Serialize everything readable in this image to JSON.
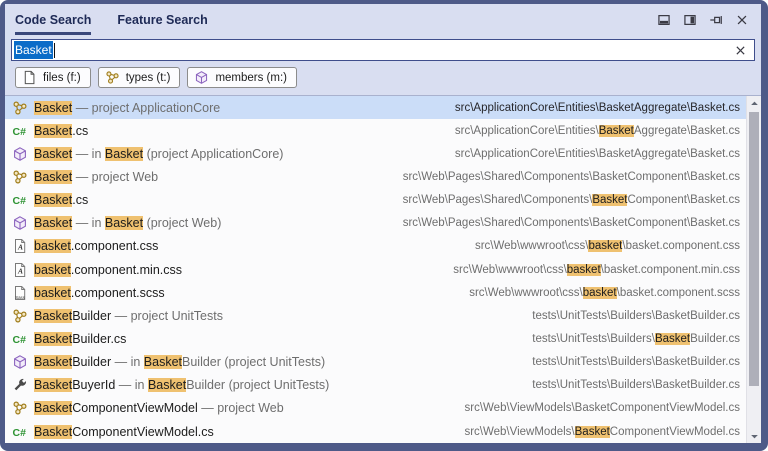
{
  "tabs": [
    {
      "label": "Code Search",
      "active": true
    },
    {
      "label": "Feature Search",
      "active": false
    }
  ],
  "window_buttons": [
    {
      "icon": "dock-bottom"
    },
    {
      "icon": "dock-right"
    },
    {
      "icon": "pin"
    },
    {
      "icon": "close"
    }
  ],
  "search": {
    "value": "Basket"
  },
  "filters": [
    {
      "icon": "document",
      "label": "files (f:)"
    },
    {
      "icon": "class",
      "label": "types (t:)"
    },
    {
      "icon": "method",
      "label": "members (m:)"
    }
  ],
  "colors": {
    "window_border": "#4E5A88",
    "panel_background": "#D9DEF1",
    "selection_blue": "#0B6CC8",
    "selected_row": "#CBDDF8",
    "match_highlight": "#EFC170",
    "icon_gold": "#A07D1C",
    "icon_green": "#2E9333",
    "icon_purple": "#8B63BE"
  },
  "results": {
    "rows": [
      {
        "icon": "class",
        "selected": true,
        "name": [
          {
            "t": "Basket",
            "s": "hl"
          },
          {
            "t": " — project ApplicationCore",
            "s": "gray"
          }
        ],
        "path": [
          {
            "t": "src\\ApplicationCore\\Entities\\BasketAggregate\\Basket.cs"
          }
        ]
      },
      {
        "icon": "csharp",
        "name": [
          {
            "t": "Basket",
            "s": "hl"
          },
          {
            "t": ".cs"
          }
        ],
        "path": [
          {
            "t": "src\\ApplicationCore\\Entities\\",
            "s": "gray"
          },
          {
            "t": "Basket",
            "s": "hl"
          },
          {
            "t": "Aggregate\\Basket.cs",
            "s": "gray"
          }
        ]
      },
      {
        "icon": "method",
        "name": [
          {
            "t": "Basket",
            "s": "hl"
          },
          {
            "t": " — in ",
            "s": "gray"
          },
          {
            "t": "Basket",
            "s": "hl"
          },
          {
            "t": " (project ApplicationCore)",
            "s": "gray"
          }
        ],
        "path": [
          {
            "t": "src\\ApplicationCore\\Entities\\BasketAggregate\\Basket.cs",
            "s": "gray"
          }
        ]
      },
      {
        "icon": "class",
        "name": [
          {
            "t": "Basket",
            "s": "hl"
          },
          {
            "t": " — project Web",
            "s": "gray"
          }
        ],
        "path": [
          {
            "t": "src\\Web\\Pages\\Shared\\Components\\BasketComponent\\Basket.cs",
            "s": "gray"
          }
        ]
      },
      {
        "icon": "csharp",
        "name": [
          {
            "t": "Basket",
            "s": "hl"
          },
          {
            "t": ".cs"
          }
        ],
        "path": [
          {
            "t": "src\\Web\\Pages\\Shared\\Components\\",
            "s": "gray"
          },
          {
            "t": "Basket",
            "s": "hl"
          },
          {
            "t": "Component\\Basket.cs",
            "s": "gray"
          }
        ]
      },
      {
        "icon": "method",
        "name": [
          {
            "t": "Basket",
            "s": "hl"
          },
          {
            "t": " — in ",
            "s": "gray"
          },
          {
            "t": "Basket",
            "s": "hl"
          },
          {
            "t": " (project Web)",
            "s": "gray"
          }
        ],
        "path": [
          {
            "t": "src\\Web\\Pages\\Shared\\Components\\BasketComponent\\Basket.cs",
            "s": "gray"
          }
        ]
      },
      {
        "icon": "css-file",
        "name": [
          {
            "t": "basket",
            "s": "hl"
          },
          {
            "t": ".component.css"
          }
        ],
        "path": [
          {
            "t": "src\\Web\\wwwroot\\css\\",
            "s": "gray"
          },
          {
            "t": "basket",
            "s": "hl"
          },
          {
            "t": "\\basket.component.css",
            "s": "gray"
          }
        ]
      },
      {
        "icon": "css-file",
        "name": [
          {
            "t": "basket",
            "s": "hl"
          },
          {
            "t": ".component.min.css"
          }
        ],
        "path": [
          {
            "t": "src\\Web\\wwwroot\\css\\",
            "s": "gray"
          },
          {
            "t": "basket",
            "s": "hl"
          },
          {
            "t": "\\basket.component.min.css",
            "s": "gray"
          }
        ]
      },
      {
        "icon": "scss-file",
        "name": [
          {
            "t": "basket",
            "s": "hl"
          },
          {
            "t": ".component.scss"
          }
        ],
        "path": [
          {
            "t": "src\\Web\\wwwroot\\css\\",
            "s": "gray"
          },
          {
            "t": "basket",
            "s": "hl"
          },
          {
            "t": "\\basket.component.scss",
            "s": "gray"
          }
        ]
      },
      {
        "icon": "class",
        "name": [
          {
            "t": "Basket",
            "s": "hl"
          },
          {
            "t": "Builder"
          },
          {
            "t": " — project UnitTests",
            "s": "gray"
          }
        ],
        "path": [
          {
            "t": "tests\\UnitTests\\Builders\\BasketBuilder.cs",
            "s": "gray"
          }
        ]
      },
      {
        "icon": "csharp",
        "name": [
          {
            "t": "Basket",
            "s": "hl"
          },
          {
            "t": "Builder.cs"
          }
        ],
        "path": [
          {
            "t": "tests\\UnitTests\\Builders\\",
            "s": "gray"
          },
          {
            "t": "Basket",
            "s": "hl"
          },
          {
            "t": "Builder.cs",
            "s": "gray"
          }
        ]
      },
      {
        "icon": "method",
        "name": [
          {
            "t": "Basket",
            "s": "hl"
          },
          {
            "t": "Builder"
          },
          {
            "t": " — in ",
            "s": "gray"
          },
          {
            "t": "Basket",
            "s": "hl"
          },
          {
            "t": "Builder (project UnitTests)",
            "s": "gray"
          }
        ],
        "path": [
          {
            "t": "tests\\UnitTests\\Builders\\BasketBuilder.cs",
            "s": "gray"
          }
        ]
      },
      {
        "icon": "property",
        "name": [
          {
            "t": "Basket",
            "s": "hl"
          },
          {
            "t": "BuyerId"
          },
          {
            "t": " — in ",
            "s": "gray"
          },
          {
            "t": "Basket",
            "s": "hl"
          },
          {
            "t": "Builder (project UnitTests)",
            "s": "gray"
          }
        ],
        "path": [
          {
            "t": "tests\\UnitTests\\Builders\\BasketBuilder.cs",
            "s": "gray"
          }
        ]
      },
      {
        "icon": "class",
        "name": [
          {
            "t": "Basket",
            "s": "hl"
          },
          {
            "t": "ComponentViewModel"
          },
          {
            "t": " — project Web",
            "s": "gray"
          }
        ],
        "path": [
          {
            "t": "src\\Web\\ViewModels\\BasketComponentViewModel.cs",
            "s": "gray"
          }
        ]
      },
      {
        "icon": "csharp",
        "name": [
          {
            "t": "Basket",
            "s": "hl"
          },
          {
            "t": "ComponentViewModel.cs"
          }
        ],
        "path": [
          {
            "t": "src\\Web\\ViewModels\\",
            "s": "gray"
          },
          {
            "t": "Basket",
            "s": "hl"
          },
          {
            "t": "ComponentViewModel.cs",
            "s": "gray"
          }
        ]
      }
    ]
  }
}
